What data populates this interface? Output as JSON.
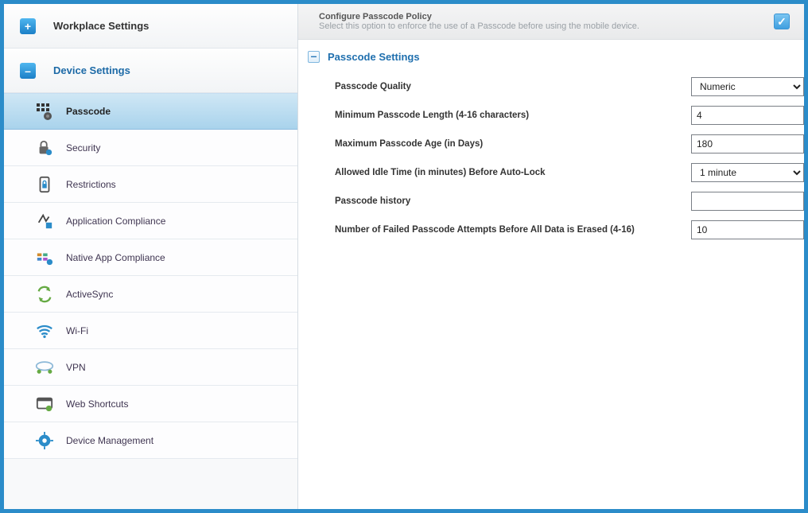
{
  "sidebar": {
    "sections": [
      {
        "id": "workplace",
        "title": "Workplace Settings",
        "expanded": false
      },
      {
        "id": "device",
        "title": "Device Settings",
        "expanded": true,
        "items": [
          {
            "id": "passcode",
            "label": "Passcode",
            "icon": "passcode-icon",
            "active": true
          },
          {
            "id": "security",
            "label": "Security",
            "icon": "lock-gear-icon",
            "active": false
          },
          {
            "id": "restrictions",
            "label": "Restrictions",
            "icon": "phone-lock-icon",
            "active": false
          },
          {
            "id": "appcomp",
            "label": "Application Compliance",
            "icon": "app-compliance-icon",
            "active": false
          },
          {
            "id": "nativecomp",
            "label": "Native App Compliance",
            "icon": "native-app-icon",
            "active": false
          },
          {
            "id": "activesync",
            "label": "ActiveSync",
            "icon": "activesync-icon",
            "active": false
          },
          {
            "id": "wifi",
            "label": "Wi-Fi",
            "icon": "wifi-icon",
            "active": false
          },
          {
            "id": "vpn",
            "label": "VPN",
            "icon": "vpn-icon",
            "active": false
          },
          {
            "id": "webshort",
            "label": "Web Shortcuts",
            "icon": "web-shortcuts-icon",
            "active": false
          },
          {
            "id": "devmgmt",
            "label": "Device Management",
            "icon": "gear-icon",
            "active": false
          }
        ]
      }
    ]
  },
  "configure_policy": {
    "title": "Configure Passcode Policy",
    "description": "Select this option to enforce the use of a Passcode before using the mobile device.",
    "checked": true
  },
  "passcode_section": {
    "title": "Passcode Settings",
    "fields": {
      "quality": {
        "label": "Passcode Quality",
        "value": "Numeric",
        "type": "select"
      },
      "min_length": {
        "label": "Minimum Passcode Length (4-16 characters)",
        "value": "4",
        "type": "text"
      },
      "max_age": {
        "label": "Maximum Passcode Age (in Days)",
        "value": "180",
        "type": "text"
      },
      "idle_time": {
        "label": "Allowed Idle Time (in minutes) Before Auto-Lock",
        "value": "1 minute",
        "type": "select"
      },
      "history": {
        "label": "Passcode history",
        "value": "",
        "type": "text"
      },
      "failed_attempts": {
        "label": "Number of Failed Passcode Attempts Before All Data is Erased (4-16)",
        "value": "10",
        "type": "text"
      }
    }
  }
}
